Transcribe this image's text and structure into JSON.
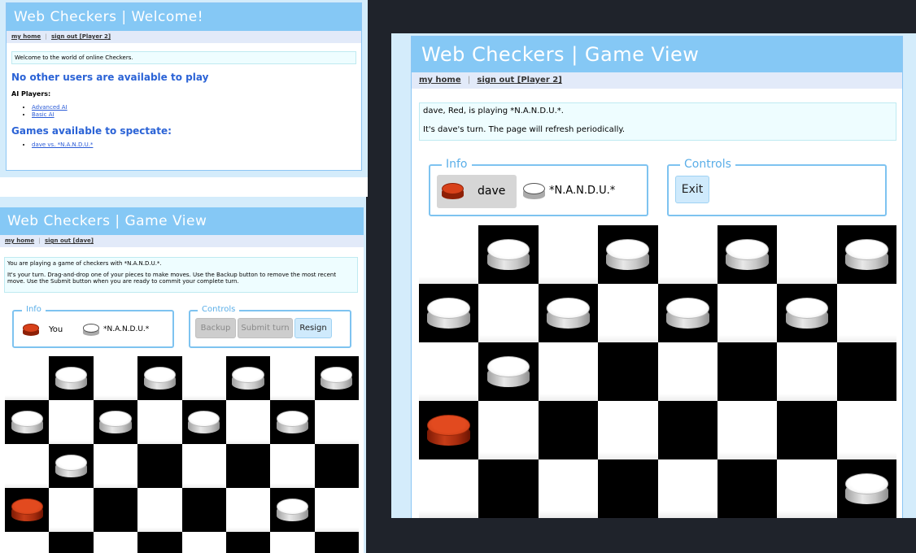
{
  "welcome": {
    "title": "Web Checkers | Welcome!",
    "nav": {
      "home": "my home",
      "separator": "|",
      "signout": "sign out [Player 2]"
    },
    "message": "Welcome to the world of online Checkers.",
    "no_users": "No other users are available to play",
    "ai_heading": "AI Players:",
    "ai_players": [
      "Advanced AI",
      "Basic AI"
    ],
    "spectate_heading": "Games available to spectate:",
    "spectate_games": [
      "dave vs. *N.A.N.D.U.*"
    ]
  },
  "game_player": {
    "title": "Web Checkers | Game View",
    "nav": {
      "home": "my home",
      "separator": "|",
      "signout": "sign out [dave]"
    },
    "message_line1": "You are playing a game of checkers with *N.A.N.D.U.*.",
    "message_line2": "It's your turn. Drag-and-drop one of your pieces to make moves. Use the Backup button to remove the most recent move. Use the Submit button when you are ready to commit your complete turn.",
    "info_legend": "Info",
    "red_player": "You",
    "white_player": "*N.A.N.D.U.*",
    "controls_legend": "Controls",
    "buttons": {
      "backup": "Backup",
      "submit": "Submit turn",
      "resign": "Resign"
    }
  },
  "game_spectator": {
    "title": "Web Checkers | Game View",
    "nav": {
      "home": "my home",
      "separator": "|",
      "signout": "sign out [Player 2]"
    },
    "message_line1": "dave, Red, is playing *N.A.N.D.U.*.",
    "message_line2": "It's dave's turn. The page will refresh periodically.",
    "info_legend": "Info",
    "red_player": "dave",
    "white_player": "*N.A.N.D.U.*",
    "controls_legend": "Controls",
    "buttons": {
      "exit": "Exit"
    }
  },
  "boards": {
    "player": [
      "-W-W-W-W",
      "W-W-W-W-",
      "-W------",
      "R-----W-",
      "--------"
    ],
    "spectator": [
      "-W-W-W-W",
      "W-W-W-W-",
      "-W------",
      "R-------",
      "-------W"
    ]
  },
  "colors": {
    "header": "#85c8f5",
    "nav_bg": "#e2eaf9",
    "message_bg": "#eefdff",
    "legend": "#5aaee8",
    "red_piece": "#d8411a",
    "white_piece": "#ffffff",
    "dark_square": "#000000",
    "light_square": "#ffffff"
  },
  "icons": {
    "red_piece": "red-checker-piece-icon",
    "white_piece": "white-checker-piece-icon"
  }
}
